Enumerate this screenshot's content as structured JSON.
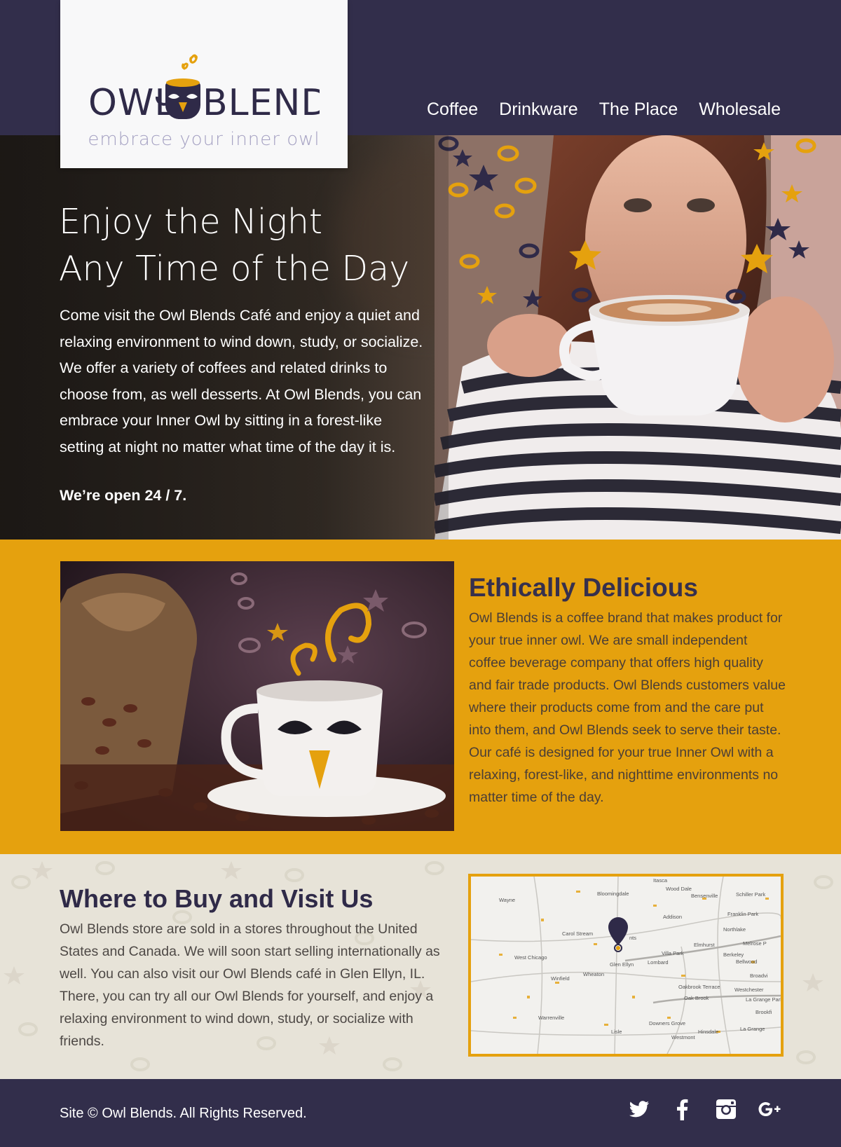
{
  "brand": {
    "logo_left": "OWL",
    "logo_right": "BLENDS",
    "tagline": "embrace your inner owl"
  },
  "nav": {
    "items": [
      {
        "label": "Coffee"
      },
      {
        "label": "Drinkware"
      },
      {
        "label": "The Place"
      },
      {
        "label": "Wholesale"
      }
    ]
  },
  "hero": {
    "title_line1": "Enjoy the Night",
    "title_line2": "Any Time of the Day",
    "body": "Come visit the Owl Blends Café and enjoy a quiet and relaxing environment to wind down, study, or socialize. We offer a variety of coffees and related drinks to choose from, as well desserts. At Owl Blends, you can embrace your Inner Owl by sitting in a forest-like setting at night no matter what time of the day it is.",
    "open": "We’re open 24 / 7."
  },
  "ethic": {
    "title": "Ethically Delicious",
    "body": "Owl Blends is a coffee brand that makes product for your true inner owl. We are small independent coffee beverage company that offers high quality and fair trade products. Owl Blends customers value where their products come from and the care put into them, and Owl Blends seek to serve their taste. Our café is designed for your true Inner Owl  with a relaxing, forest-like, and nighttime environments no matter time of the day."
  },
  "visit": {
    "title": "Where to Buy and Visit Us",
    "body": "Owl Blends store are sold in a stores throughout the United States and Canada. We will soon start selling internationally as well. You can also visit our Owl Blends café in Glen Ellyn, IL. There, you can try all our Owl Blends for yourself, and enjoy a relaxing environment to wind down, study, or socialize with friends."
  },
  "map": {
    "labels": [
      "Itasca",
      "Wood Dale",
      "Bensenville",
      "Schiller Park",
      "Bloomingdale",
      "Wayne",
      "Franklin Park",
      "Addison",
      "Northlake",
      "Carol Stream",
      "Elmhurst",
      "Melrose P",
      "Villa Park",
      "Berkeley",
      "Bellwood",
      "West Chicago",
      "Glen Ellyn",
      "Lombard",
      "Broadvi",
      "Wheaton",
      "Winfield",
      "Oakbrook Terrace",
      "Westchester",
      "Oak Brook",
      "La Grange Park",
      "Brookfi",
      "Warrenville",
      "Downers Grove",
      "La Grange",
      "Lisle",
      "Hinsdale",
      "Westmont",
      "nts"
    ]
  },
  "footer": {
    "copyright": "Site © Owl Blends. All Rights Reserved.",
    "social": [
      "twitter-icon",
      "facebook-icon",
      "instagram-icon",
      "google-plus-icon"
    ]
  },
  "colors": {
    "navy": "#322e4b",
    "gold": "#e5a10e",
    "cream": "#e7e3d8",
    "lavender": "#a4a0c2"
  }
}
